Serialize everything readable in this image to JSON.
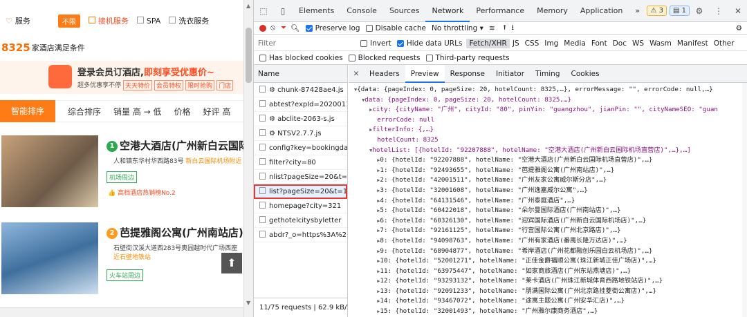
{
  "site": {
    "services": {
      "label": "服务",
      "unlimited": "不限",
      "opt1": "接机服务",
      "opt2": "SPA",
      "opt3": "洗衣服务"
    },
    "hotel_count": "8325",
    "hotel_count_suffix": "家酒店满足条件",
    "banner": {
      "title_a": "登录会员订酒店,",
      "title_b": "即刻享受优惠价~",
      "sub": "超多优惠享不停",
      "tags": [
        "天天特价",
        "会员特权",
        "限时抢购",
        "门店"
      ]
    },
    "sort": [
      "智能排序",
      "综合排序",
      "销量 高 → 低",
      "价格",
      "好评 高"
    ],
    "hotels": [
      {
        "num": "1",
        "name": "空港大酒店(广州新白云国际机",
        "addr": "人和镇东华村华西路83号",
        "addr_hl": "新白云国际机场附近",
        "tag": "机场周边",
        "hot": "高档酒店热销榜No.2"
      },
      {
        "num": "2",
        "name": "芭提雅阁公寓(广州南站店)",
        "addr": "石壁街汉溪大道西283号奥园越时代广场西座",
        "addr_hl": "近石壁地铁站",
        "tag": "火车站周边"
      }
    ]
  },
  "devtools": {
    "tabs": [
      "Elements",
      "Console",
      "Sources",
      "Network",
      "Performance",
      "Memory",
      "Application",
      "»"
    ],
    "active_tab": "Network",
    "warn_count": "3",
    "msg_count": "1",
    "toolbar": {
      "preserve": "Preserve log",
      "disable_cache": "Disable cache",
      "throttle": "No throttling"
    },
    "filter": {
      "placeholder": "Filter",
      "invert": "Invert",
      "hide_urls": "Hide data URLs",
      "types": [
        "Fetch/XHR",
        "JS",
        "CSS",
        "Img",
        "Media",
        "Font",
        "Doc",
        "WS",
        "Wasm",
        "Manifest",
        "Other"
      ]
    },
    "blocked": {
      "cookies": "Has blocked cookies",
      "requests": "Blocked requests",
      "third": "Third-party requests"
    },
    "names_header": "Name",
    "requests": [
      "⚙ chunk-87428ae4.js",
      "abtest?expId=2020011...",
      "⚙ abclite-2063-s.js",
      "⚙ NTSV2.7.7.js",
      "config?key=bookingda...",
      "filter?city=80",
      "nlist?pageSize=20&t=...",
      "list?pageSize=20&t=1...",
      "homepage?city=321",
      "gethotelcitysbyletter",
      "abdr?_o=https%3A%2..."
    ],
    "footer": "11/75 requests  |  62.9 kB/1",
    "detail_tabs": [
      "Headers",
      "Preview",
      "Response",
      "Initiator",
      "Timing",
      "Cookies"
    ],
    "json": {
      "l0": "{data: {pageIndex: 0, pageSize: 20, hotelCount: 8325,…}, errorMessage: \"\", errorCode: null,…}",
      "l1": "data: {pageIndex: 0, pageSize: 20, hotelCount: 8325,…}",
      "l2": "city: {cityName: \"广州\", cityId: \"80\", pinYin: \"guangzhou\", jianPin: \"\", cityNameSEO: \"guan",
      "l3": "errorCode: null",
      "l4": "filterInfo: {,…}",
      "l5": "hotelCount: 8325",
      "l6": "hotelList: [{hotelId: \"92207888\", hotelName: \"空港大酒店(广州新白云国际机场直营店)\",…},…]",
      "items": [
        "0: {hotelId: \"92207888\", hotelName: \"空港大酒店(广州新白云国际机场直营店)\",…}",
        "1: {hotelId: \"92493655\", hotelName: \"芭提雅阁公寓(广州南站店)\",…}",
        "2: {hotelId: \"42001511\", hotelName: \"广州友家公寓威尔斯分店\",…}",
        "3: {hotelId: \"32001608\", hotelName: \"广州逸嘉威尔公寓\",…}",
        "4: {hotelId: \"64131546\", hotelName: \"广州泰庭酒店\",…}",
        "5: {hotelId: \"60422018\", hotelName: \"朵尔曼国际酒店(广州南站店)\",…}",
        "6: {hotelId: \"60326130\", hotelName: \"迎宾国际酒店(广州新白云国际机场店)\",…}",
        "7: {hotelId: \"92161125\", hotelName: \"行宫国际公寓(广州北京路店)\",…}",
        "8: {hotelId: \"94098763\", hotelName: \"广州有家酒店(番禺长隆万达店)\",…}",
        "9: {hotelId: \"68904877\", hotelName: \"希岸酒店(广州花都融创乐园白云机场店)\",…}",
        "10: {hotelId: \"52001271\", hotelName: \"正佳金爵福顺公寓(珠江新城正佳广场店)\",…}",
        "11: {hotelId: \"63975447\", hotelName: \"如家商旅酒店(广州东站燕塘店)\",…}",
        "12: {hotelId: \"93293132\", hotelName: \"莱卡酒店(广州珠江新城体育西路地铁站店)\",…}",
        "13: {hotelId: \"92091233\", hotelName: \"朋满国际公寓(广州北京路挂菱街公寓店)\",…}",
        "14: {hotelId: \"93467072\", hotelName: \"途寓主题公寓(广州安华汇店)\",…}",
        "15: {hotelId: \"32001493\", hotelName: \"广州雅尔康商务酒店\",…}"
      ]
    }
  },
  "colors": {
    "accent": "#ff7b15",
    "devtools_blue": "#1a73e8",
    "highlight": "#e53935"
  }
}
